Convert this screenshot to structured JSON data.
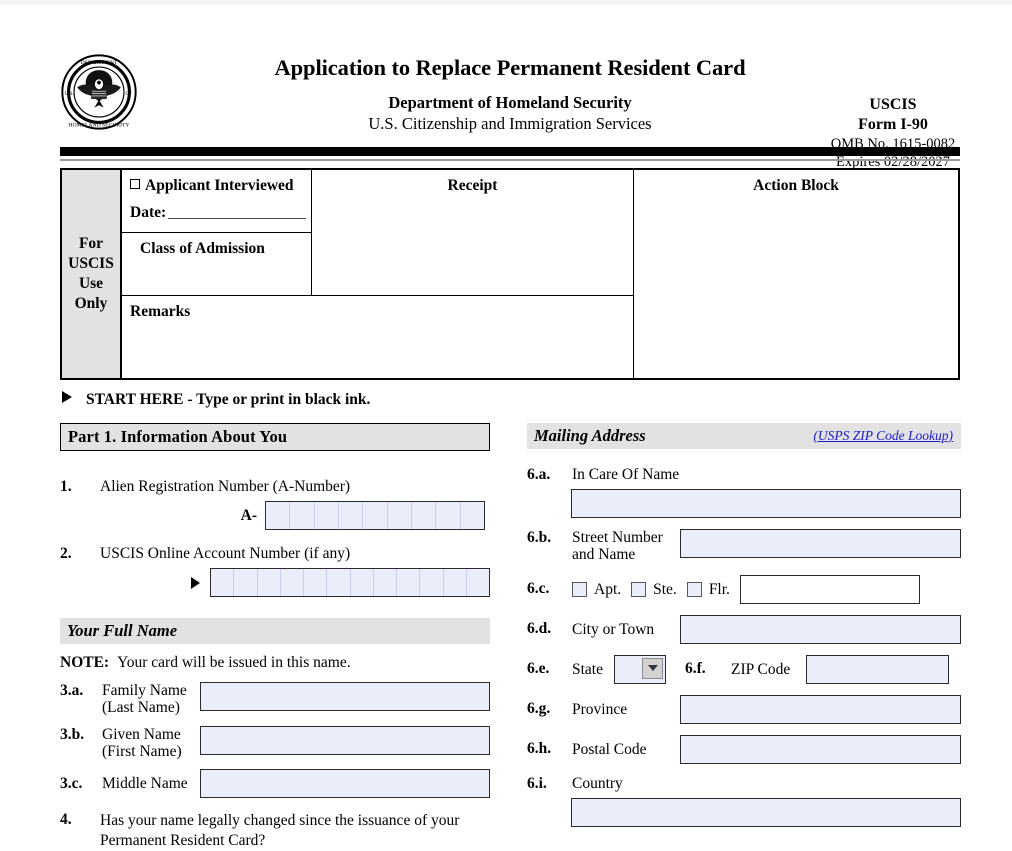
{
  "header": {
    "seal_alt": "Department of Homeland Security seal",
    "title": "Application to Replace Permanent Resident Card",
    "agency": "Department of Homeland Security",
    "bureau": "U.S. Citizenship and Immigration Services",
    "uscis_label": "USCIS",
    "form_number": "Form I-90",
    "omb": "OMB No. 1615-0082",
    "expires": "Expires 02/28/2027"
  },
  "uscis_use": {
    "side_label_lines": [
      "For",
      "USCIS",
      "Use",
      "Only"
    ],
    "applicant_interviewed": "Applicant Interviewed",
    "date_label": "Date:",
    "class_of_admission": "Class of Admission",
    "remarks": "Remarks",
    "receipt": "Receipt",
    "action_block": "Action Block"
  },
  "start_here": "START HERE - Type or print in black ink.",
  "left_column": {
    "part_header": "Part 1.  Information About You",
    "item1": {
      "number": "1.",
      "label": "Alien Registration Number (A-Number)",
      "prefix": "A-",
      "cells": 9
    },
    "item2": {
      "number": "2.",
      "label": "USCIS Online Account Number (if any)",
      "cells": 12
    },
    "full_name_header": "Your Full Name",
    "note_prefix": "NOTE:",
    "note_text": "Your card will be issued in this name.",
    "item3a": {
      "number": "3.a.",
      "label_line1": "Family Name",
      "label_line2": "(Last Name)"
    },
    "item3b": {
      "number": "3.b.",
      "label_line1": "Given Name",
      "label_line2": "(First Name)"
    },
    "item3c": {
      "number": "3.c.",
      "label_line1": "Middle Name"
    },
    "item4": {
      "number": "4.",
      "label_line1": "Has your name legally changed since the issuance of your",
      "label_line2": "Permanent Resident Card?"
    }
  },
  "right_column": {
    "mailing_header": "Mailing Address",
    "usps_link": "(USPS ZIP Code Lookup)",
    "item6a": {
      "number": "6.a.",
      "label": "In Care Of Name"
    },
    "item6b": {
      "number": "6.b.",
      "label_line1": "Street Number",
      "label_line2": "and Name"
    },
    "item6c": {
      "number": "6.c.",
      "options": [
        "Apt.",
        "Ste.",
        "Flr."
      ]
    },
    "item6d": {
      "number": "6.d.",
      "label": "City or Town"
    },
    "item6e": {
      "number": "6.e.",
      "label": "State",
      "value": ""
    },
    "item6f": {
      "number": "6.f.",
      "label": "ZIP Code"
    },
    "item6g": {
      "number": "6.g.",
      "label": "Province"
    },
    "item6h": {
      "number": "6.h.",
      "label": "Postal Code"
    },
    "item6i": {
      "number": "6.i.",
      "label": "Country"
    }
  },
  "colors": {
    "field_fill": "#eaeefa",
    "section_gray": "#e2e2e2",
    "link_blue": "#1b1bd0"
  }
}
